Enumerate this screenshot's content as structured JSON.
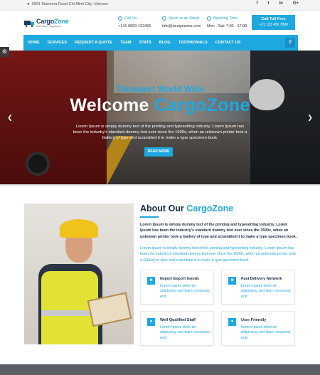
{
  "topbar": {
    "address": "0901 Marmora Road Chi Minh City, Vietnam",
    "social": [
      "f",
      "t",
      "in",
      "G+"
    ]
  },
  "header": {
    "logo_main": "Cargo",
    "logo_accent": "Zone",
    "logo_tagline": "We Deliver Happiness",
    "call_label": "Call Us",
    "call_value": "+141 0800-123456",
    "email_label": "Send us an Email",
    "email_value": "info@dezigezone.com",
    "opening_label": "Opening Time",
    "opening_value": "Mon - Sat: 7:00 - 17:00",
    "toll_label": "Call Toll Free",
    "toll_value": "+31 123 456 7890"
  },
  "nav": {
    "items": [
      "HOME",
      "SERVICES",
      "REQUEST A QUOTE",
      "TEAM",
      "STATS",
      "BLOG",
      "TESTIMONIALS",
      "CONTACT US"
    ]
  },
  "hero": {
    "subtitle": "Transport World Wide",
    "title_main": "Welcome ",
    "title_accent": "CargoZone",
    "description": "Lorem Ipsum is simply dummy text of the printing and typesetting industry. Lorem Ipsum has been the industry's standard dummy text ever since the 1500s, when an unknown printer took a Gallery of type and scrambled it to make a type specimen book.",
    "button": "READ MORE"
  },
  "about": {
    "heading_main": "About Our ",
    "heading_accent": "CargoZone",
    "para1": "Lorem Ipsum is simply dummy text of the printing and typesetting industry. Lorem Ipsum has been the industry's standard dummy text ever since the 1500s, when an unknown printer took a Gallery of type and scrambled it to make a type specimen book.",
    "para2": "Lorem Ipsum is simply dummy text of the printing and typesetting industry. Lorem Ipsum has been the industry's standard dummy text ever since the 1500s, when an unknown printer took a Gallery of type and scrambled it to make a type specimen book.",
    "features": [
      {
        "title": "Import Export Goods",
        "desc": "Lorem Ipsum dolor sit adipiscing sed diam nonummy end."
      },
      {
        "title": "Fast Delivery Network",
        "desc": "Lorem Ipsum dolor sit adipiscing sed diam nonummy end."
      },
      {
        "title": "Well Qualified Staff",
        "desc": "Lorem Ipsum dolor sit adipiscing sed diam nonummy end."
      },
      {
        "title": "User Friendly",
        "desc": "Lorem Ipsum dolor sit adipiscing sed diam nonummy end."
      }
    ]
  },
  "colors": {
    "accent": "#1ea8e0",
    "dark_text": "#1b2a41",
    "footer": "#5c5f66"
  },
  "icons": [
    "map-pin-icon",
    "facebook-icon",
    "twitter-icon",
    "linkedin-icon",
    "google-plus-icon",
    "phone-icon",
    "email-icon",
    "clock-icon",
    "search-icon",
    "settings-gear-icon",
    "chevron-left-icon",
    "chevron-right-icon"
  ]
}
